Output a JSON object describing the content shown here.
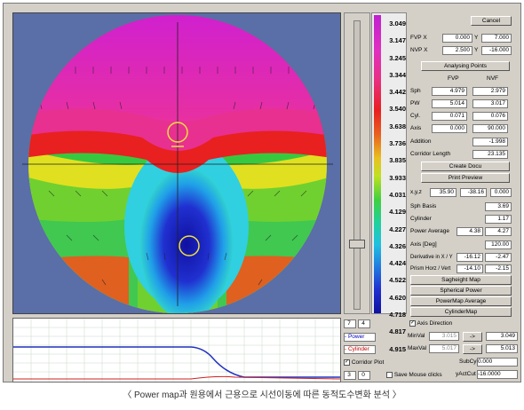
{
  "legend": {
    "values": [
      "3.049",
      "3.147",
      "3.245",
      "3.344",
      "3.442",
      "3.540",
      "3.638",
      "3.736",
      "3.835",
      "3.933",
      "4.031",
      "4.129",
      "4.227",
      "4.326",
      "4.424",
      "4.522",
      "4.620",
      "4.718",
      "4.817",
      "4.915"
    ]
  },
  "buttons": {
    "cancel": "Cancel",
    "analysing_points": "Analysing Points",
    "create_docu": "Create Docu",
    "print_preview": "Print Preview",
    "sagheight_map": "Sagheight Map",
    "spherical_power": "Spherical Power",
    "powermap_average": "PowerMap Average",
    "cylinder_map": "CylinderMap",
    "arrow1": "->",
    "arrow2": "->"
  },
  "fvp": {
    "label": "FVP",
    "x_label": "X",
    "y_label": "Y",
    "x": "0.000",
    "y": "7.000"
  },
  "nvp": {
    "label": "NVP",
    "x_label": "X",
    "y_label": "Y",
    "x": "2.500",
    "y": "-16.000"
  },
  "table": {
    "col_fvp": "FVP",
    "col_nvf": "NVF",
    "rows": [
      {
        "label": "Sph",
        "fvp": "4.979",
        "nvf": "2.979"
      },
      {
        "label": "PW",
        "fvp": "5.014",
        "nvf": "3.017"
      },
      {
        "label": "Cyl.",
        "fvp": "0.071",
        "nvf": "0.076"
      },
      {
        "label": "Axis",
        "fvp": "0.000",
        "nvf": "90.000"
      }
    ]
  },
  "addition": {
    "label": "Addition",
    "value": "-1.998"
  },
  "corridor": {
    "label": "Corridor Length",
    "value": "23.135"
  },
  "xyz": {
    "label": "x,y,z",
    "x": "35.90",
    "y": "-38.16",
    "z": "0.000"
  },
  "sph_basis": {
    "label": "Sph Basis",
    "value": "3.69"
  },
  "cylinder": {
    "label": "Cylinder",
    "value": "1.17"
  },
  "power_avg": {
    "label": "Power Average",
    "v1": "4.38",
    "v2": "4.27"
  },
  "axis_deg": {
    "label": "Axis [Deg]",
    "value": "120.00"
  },
  "derivative": {
    "label": "Derivative in X / Y",
    "v1": "-16.12",
    "v2": "-2.47"
  },
  "prism": {
    "label": "Prism Horz / Vert",
    "v1": "-14.10",
    "v2": "-2.15"
  },
  "bottom": {
    "spin1": "7",
    "spin2": "4",
    "power_label": "- Power",
    "cylinder_label": "- Cylinder",
    "corridor_plot": "Corridor Plot",
    "axis_direction": "Axis Direction",
    "spin3": "3",
    "spin4": "0",
    "save_mouse": "Save Mouse clicks",
    "minval_label": "MinVal",
    "maxval_label": "MaxVal",
    "minval": "3.015",
    "maxval": "5.017",
    "minval_out": "3.049",
    "maxval_out": "5.013",
    "subcyl_label": "SubCyl",
    "subcyl": "0.000",
    "yactcut_label": "yActCut",
    "yactcut": "-16.0000"
  },
  "caption": "〈 Power map과 원용에서 근용으로 시선이동에 따른 동적도수변화 분석 〉",
  "colors": {
    "magenta": "#e020c8",
    "red": "#e82020",
    "yellow": "#e8e020",
    "green": "#30d040",
    "cyan": "#20d0e0",
    "blue": "#2020c0",
    "background": "#5a6ea8"
  }
}
